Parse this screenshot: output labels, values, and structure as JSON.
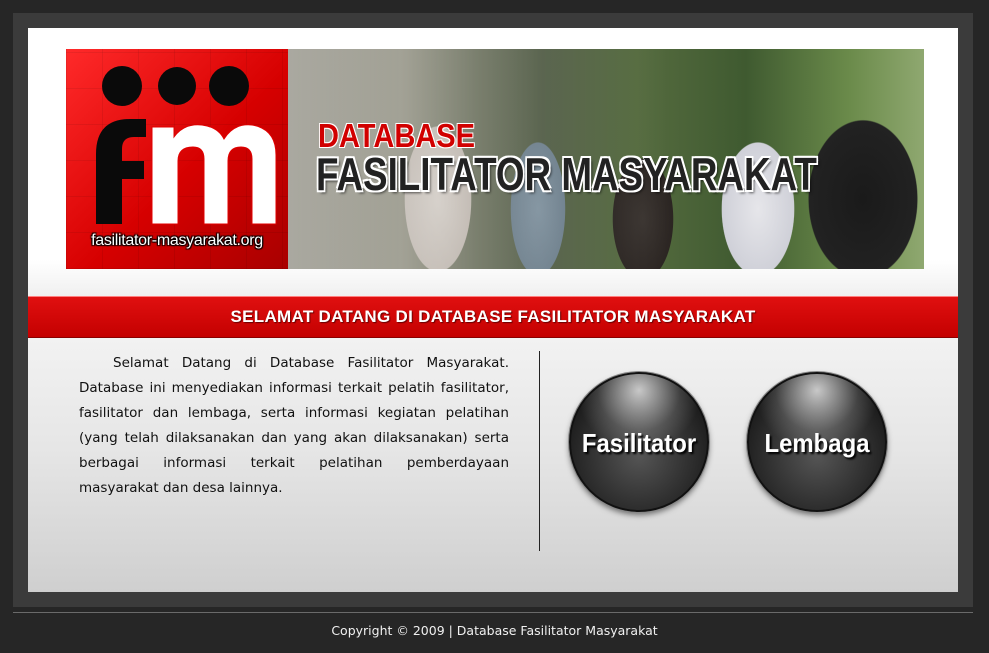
{
  "header": {
    "logo_text": "fasilitator-masyarakat.org",
    "title_line1": "DATABASE",
    "title_line2": "FASILITATOR MASYARAKAT"
  },
  "welcome": {
    "title": "SELAMAT DATANG DI DATABASE FASILITATOR MASYARAKAT",
    "body": "Selamat Datang di Database Fasilitator Masyarakat. Database ini menyediakan informasi terkait pelatih fasilitator, fasilitator dan lembaga, serta informasi kegiatan pelatihan (yang telah dilaksanakan dan yang akan dilaksanakan) serta berbagai informasi terkait pelatihan pemberdayaan masyarakat dan desa lainnya."
  },
  "buttons": {
    "fasilitator": "Fasilitator",
    "lembaga": "Lembaga"
  },
  "footer": {
    "copyright": "Copyright © 2009 | Database Fasilitator Masyarakat"
  },
  "colors": {
    "accent_red": "#d10000",
    "page_background": "#262626"
  }
}
